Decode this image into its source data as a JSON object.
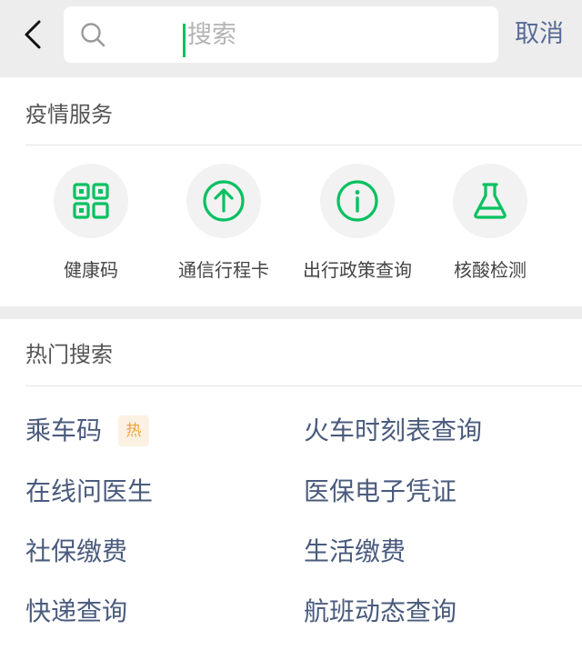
{
  "header": {
    "search_placeholder": "搜索",
    "cancel_label": "取消"
  },
  "epidemic": {
    "title": "疫情服务",
    "services": [
      {
        "label": "健康码",
        "icon": "qr-code-icon"
      },
      {
        "label": "通信行程卡",
        "icon": "arrow-up-circle-icon"
      },
      {
        "label": "出行政策查询",
        "icon": "info-circle-icon"
      },
      {
        "label": "核酸检测",
        "icon": "flask-icon"
      }
    ]
  },
  "hot": {
    "title": "热门搜索",
    "badge": "热",
    "items": [
      "乘车码",
      "火车时刻表查询",
      "在线问医生",
      "医保电子凭证",
      "社保缴费",
      "生活缴费",
      "快递查询",
      "航班动态查询"
    ]
  },
  "colors": {
    "accent": "#07c160",
    "link": "#576b95",
    "hot_text": "#4a5b7d",
    "badge_text": "#f0a23c",
    "badge_bg": "#fcf1e3"
  }
}
